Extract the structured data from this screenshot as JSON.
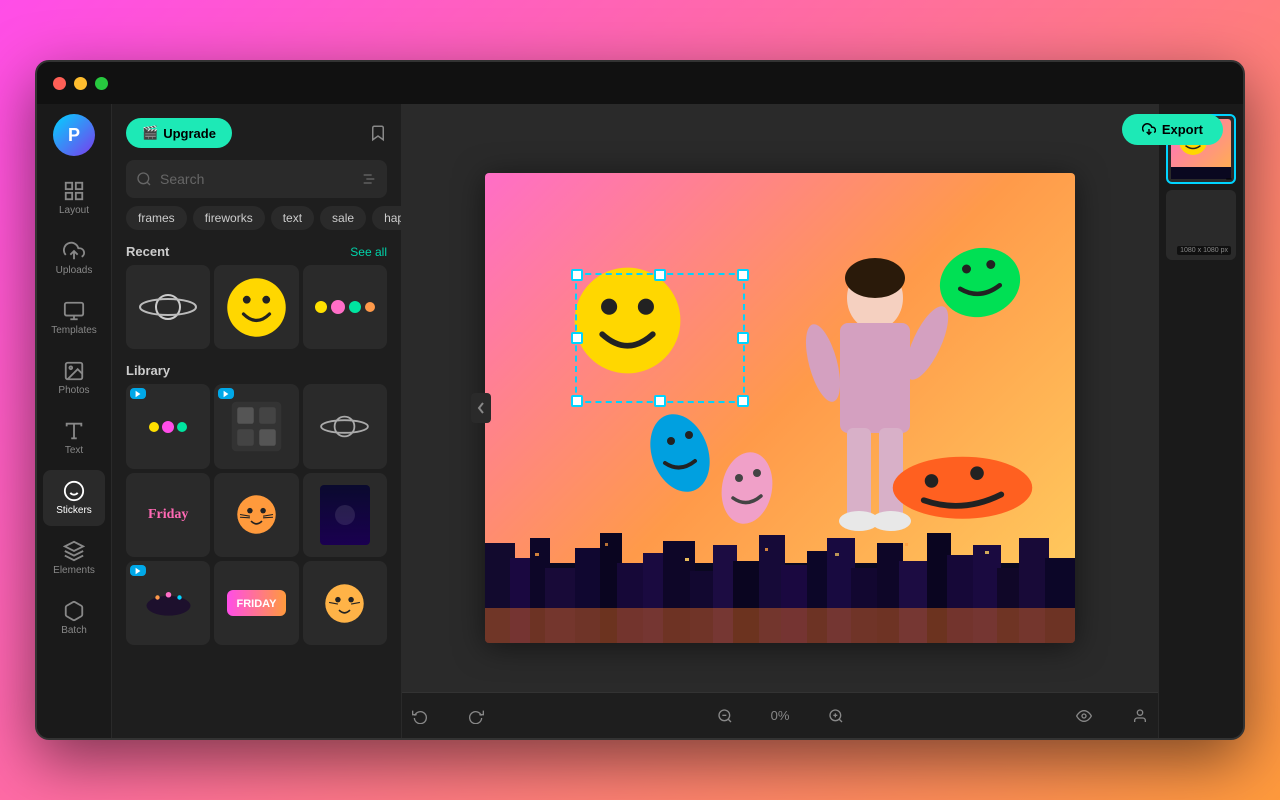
{
  "app": {
    "logo_text": "P",
    "upgrade_label": "Upgrade",
    "export_label": "Export"
  },
  "browser": {
    "dots": [
      "dot1",
      "dot2",
      "dot3"
    ]
  },
  "sidebar": {
    "items": [
      {
        "id": "layout",
        "label": "Layout"
      },
      {
        "id": "uploads",
        "label": "Uploads"
      },
      {
        "id": "templates",
        "label": "Templates"
      },
      {
        "id": "photos",
        "label": "Photos"
      },
      {
        "id": "text",
        "label": "Text"
      },
      {
        "id": "stickers",
        "label": "Stickers"
      },
      {
        "id": "elements",
        "label": "Elements"
      },
      {
        "id": "batch",
        "label": "Batch"
      }
    ]
  },
  "stickers_panel": {
    "search_placeholder": "Search",
    "tags": [
      "frames",
      "fireworks",
      "text",
      "sale",
      "happ"
    ],
    "recent_label": "Recent",
    "see_all_label": "See all",
    "library_label": "Library"
  },
  "canvas": {
    "zoom_percent": "0%",
    "dimension_label": "1080 x 1080 px"
  },
  "toolbar": {
    "undo_label": "",
    "redo_label": "",
    "zoom_out_label": "",
    "zoom_percent_label": "0%",
    "zoom_in_label": "",
    "eye_label": "",
    "person_label": ""
  }
}
